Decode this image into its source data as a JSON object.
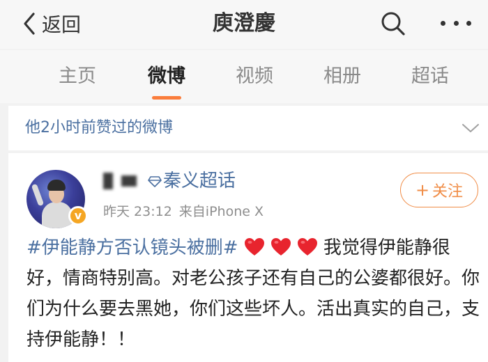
{
  "header": {
    "back_label": "返回",
    "title": "庾澄慶",
    "icons": {
      "back": "chevron-left-icon",
      "search": "search-icon",
      "more": "more-dots-icon"
    }
  },
  "tabs": [
    {
      "label": "主页",
      "active": false
    },
    {
      "label": "微博",
      "active": true
    },
    {
      "label": "视频",
      "active": false
    },
    {
      "label": "相册",
      "active": false
    },
    {
      "label": "超话",
      "active": false
    }
  ],
  "liked_bar": {
    "text": "他2小时前赞过的微博",
    "icon": "chevron-down-icon"
  },
  "post": {
    "supertopic_label": "秦义超话",
    "time": "昨天 23:12",
    "source": "来自iPhone X",
    "follow_label": "关注",
    "hashtag": "#伊能静方否认镜头被删#",
    "heart_count": 3,
    "body": "我觉得伊能静很好，情商特别高。对老公孩子还有自己的公婆都很好。你们为什么要去黑她，你们这些坏人。活出真实的自己，支持伊能静！！"
  },
  "colors": {
    "accent": "#fa7d3c",
    "link": "#4a6fa0",
    "follow": "#f08c46",
    "heart": "#e8242e",
    "verified_badge": "#f5a623"
  }
}
